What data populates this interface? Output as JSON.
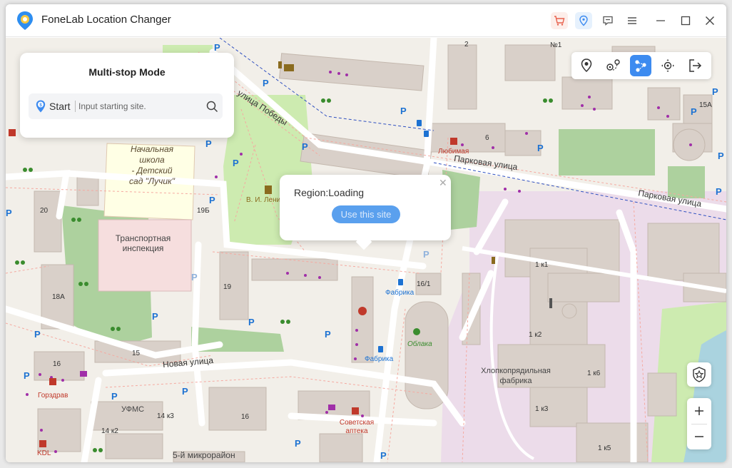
{
  "app": {
    "title": "FoneLab Location Changer"
  },
  "titlebar": {
    "icons": [
      "cart-icon",
      "pin-icon",
      "feedback-icon",
      "menu-icon",
      "minimize-icon",
      "maximize-icon",
      "close-icon"
    ],
    "accent_color": "#3d8bf0",
    "cart_color": "#e8604c"
  },
  "panel": {
    "title": "Multi-stop Mode",
    "start_label": "Start",
    "start_placeholder": "Input starting site."
  },
  "popup": {
    "region_text": "Region:Loading",
    "use_button": "Use this site"
  },
  "toolbar": {
    "tools": [
      "teleport-mode",
      "one-stop-mode",
      "multi-stop-mode",
      "joystick-mode",
      "exit"
    ],
    "active": "multi-stop-mode"
  },
  "map_labels": {
    "ulitsa_pobedy": "улица Победы",
    "parkovaya_1": "Парковая улица",
    "parkovaya_2": "Парковая улица",
    "school": [
      "Начальная",
      "школа",
      "- Детский",
      "сад \"Лучик\""
    ],
    "transport": [
      "Транспортная",
      "инспекция"
    ],
    "lenin": "В. И. Лени",
    "lyubimaya": "Любимая",
    "fabrika_1": "Фабрика",
    "fabrika_2": "Фабрика",
    "oblaka": "Облака",
    "khlopko": [
      "Хлопкопрядильная",
      "фабрика"
    ],
    "novaya": "Новая улица",
    "ufms": "УФМС",
    "gorzdrav": "Горздрав",
    "sovetskaya": [
      "Советская",
      "аптека"
    ],
    "kdl": "KDL",
    "mikrorayon": "5-й микрорайон",
    "n_1": "№1",
    "n_2": "2",
    "n_6": "6",
    "n_20": "20",
    "n_19b": "19Б",
    "n_19": "19",
    "n_18a": "18А",
    "n_16_1": "16/1",
    "n_16a": "16",
    "n_16b": "16",
    "n_15": "15",
    "n_15a": "15А",
    "n_14k3": "14 к3",
    "n_14k2": "14 к2",
    "n_1k1": "1 к1",
    "n_1k2": "1 к2",
    "n_1k6": "1 к6",
    "n_1k3": "1 к3",
    "n_1k5": "1 к5"
  }
}
